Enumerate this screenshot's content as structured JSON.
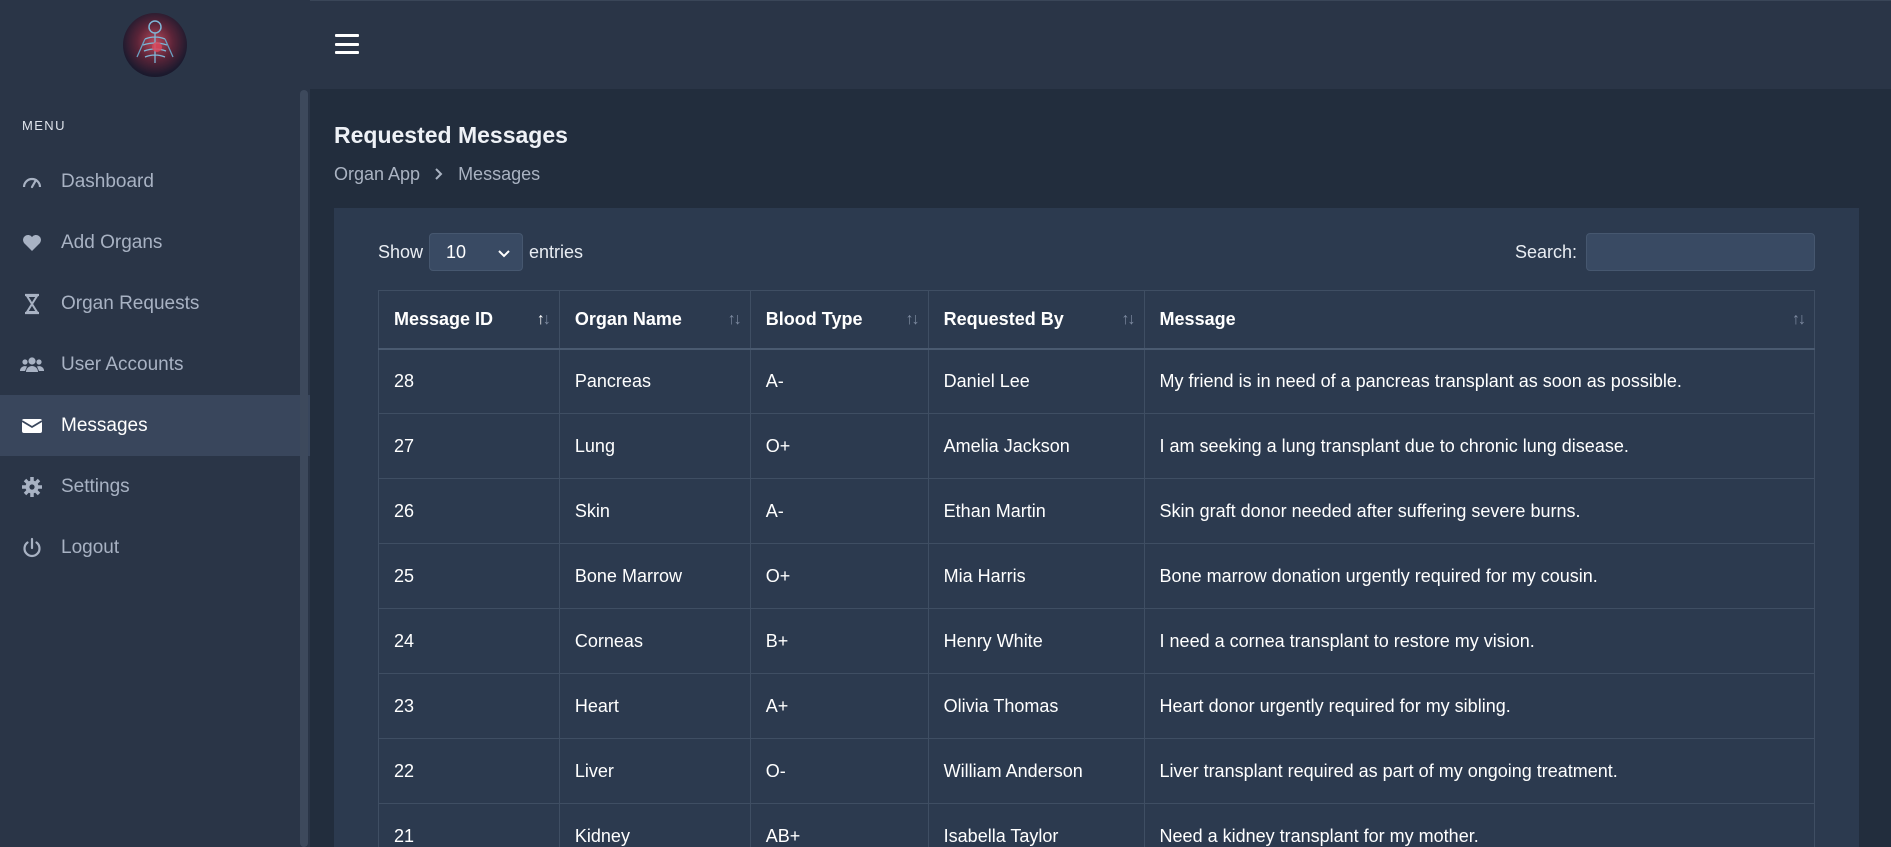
{
  "sidebar": {
    "menu_title": "MENU",
    "items": [
      {
        "label": "Dashboard",
        "icon": "gauge-icon",
        "active": false
      },
      {
        "label": "Add Organs",
        "icon": "heart-icon",
        "active": false
      },
      {
        "label": "Organ Requests",
        "icon": "hourglass-icon",
        "active": false
      },
      {
        "label": "User Accounts",
        "icon": "users-icon",
        "active": false
      },
      {
        "label": "Messages",
        "icon": "envelope-icon",
        "active": true
      },
      {
        "label": "Settings",
        "icon": "gear-icon",
        "active": false
      },
      {
        "label": "Logout",
        "icon": "power-icon",
        "active": false
      }
    ]
  },
  "header": {
    "title": "Requested Messages",
    "breadcrumb": [
      "Organ App",
      "Messages"
    ]
  },
  "table_controls": {
    "show_label": "Show",
    "entries_value": "10",
    "entries_label": "entries",
    "search_label": "Search:",
    "search_value": ""
  },
  "table": {
    "columns": [
      "Message ID",
      "Organ Name",
      "Blood Type",
      "Requested By",
      "Message"
    ],
    "rows": [
      [
        "28",
        "Pancreas",
        "A-",
        "Daniel Lee",
        "My friend is in need of a pancreas transplant as soon as possible."
      ],
      [
        "27",
        "Lung",
        "O+",
        "Amelia Jackson",
        "I am seeking a lung transplant due to chronic lung disease."
      ],
      [
        "26",
        "Skin",
        "A-",
        "Ethan Martin",
        "Skin graft donor needed after suffering severe burns."
      ],
      [
        "25",
        "Bone Marrow",
        "O+",
        "Mia Harris",
        "Bone marrow donation urgently required for my cousin."
      ],
      [
        "24",
        "Corneas",
        "B+",
        "Henry White",
        "I need a cornea transplant to restore my vision."
      ],
      [
        "23",
        "Heart",
        "A+",
        "Olivia Thomas",
        "Heart donor urgently required for my sibling."
      ],
      [
        "22",
        "Liver",
        "O-",
        "William Anderson",
        "Liver transplant required as part of my ongoing treatment."
      ],
      [
        "21",
        "Kidney",
        "AB+",
        "Isabella Taylor",
        "Need a kidney transplant for my mother."
      ]
    ]
  },
  "colors": {
    "sidebar_bg": "#2a3547",
    "active_item_bg": "#39465c",
    "card_bg": "#2c3a4f",
    "page_bg": "#222d3d"
  }
}
